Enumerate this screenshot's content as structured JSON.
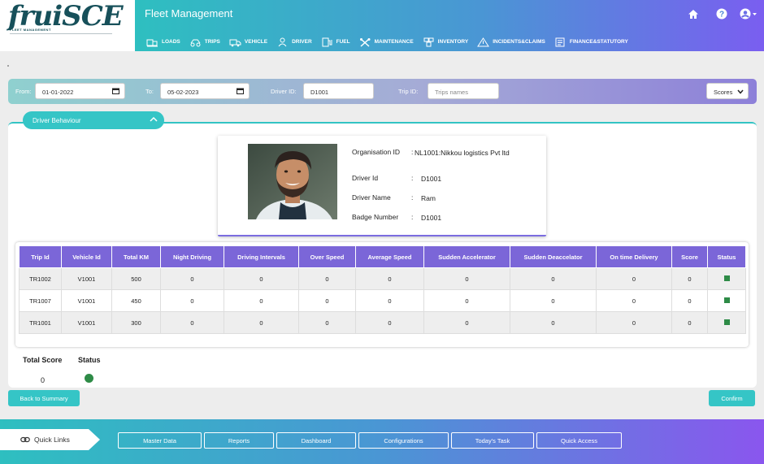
{
  "brand": {
    "logo": "fruiSCE",
    "tagline": "FLEET MANAGEMENT"
  },
  "header": {
    "title": "Fleet Management",
    "icons": [
      "home-icon",
      "help-icon",
      "user-account-icon"
    ]
  },
  "nav": [
    {
      "label": "LOADS",
      "icon": "loads-icon"
    },
    {
      "label": "TRIPS",
      "icon": "trips-icon"
    },
    {
      "label": "VEHICLE",
      "icon": "vehicle-icon"
    },
    {
      "label": "DRIVER",
      "icon": "driver-icon"
    },
    {
      "label": "FUEL",
      "icon": "fuel-icon"
    },
    {
      "label": "MAINTENANCE",
      "icon": "maintenance-icon"
    },
    {
      "label": "INVENTORY",
      "icon": "inventory-icon"
    },
    {
      "label": "INCIDENTS&CLAIMS",
      "icon": "incidents-icon"
    },
    {
      "label": "FINANCE&STATUTORY",
      "icon": "finance-icon"
    }
  ],
  "filters": {
    "from_label": "From:",
    "from_value": "01-01-2022",
    "to_label": "To:",
    "to_value": "05-02-2023",
    "driver_label": "Driver ID:",
    "driver_value": "D1001",
    "trip_label": "Trip ID:",
    "trip_placeholder": "Trips names",
    "scores_selected": "Scores"
  },
  "section": {
    "title": "Driver Behaviour"
  },
  "driver": {
    "org_label": "Organisation ID",
    "org_value": "NL1001:Nikkou logistics Pvt ltd",
    "id_label": "Driver Id",
    "id_value": "D1001",
    "name_label": "Driver Name",
    "name_value": "Ram",
    "badge_label": "Badge Number",
    "badge_value": "D1001",
    "colon": ":"
  },
  "table": {
    "headers": [
      "Trip Id",
      "Vehicle Id",
      "Total KM",
      "Night Driving",
      "Driving Intervals",
      "Over Speed",
      "Average Speed",
      "Sudden Accelerator",
      "Sudden Deaccelator",
      "On time Delivery",
      "Score",
      "Status"
    ],
    "rows": [
      [
        "TR1002",
        "V1001",
        "500",
        "0",
        "0",
        "0",
        "0",
        "0",
        "0",
        "0",
        "0",
        ""
      ],
      [
        "TR1007",
        "V1001",
        "450",
        "0",
        "0",
        "0",
        "0",
        "0",
        "0",
        "0",
        "0",
        ""
      ],
      [
        "TR1001",
        "V1001",
        "300",
        "0",
        "0",
        "0",
        "0",
        "0",
        "0",
        "0",
        "0",
        ""
      ]
    ],
    "status_color": "#2e8b47"
  },
  "summary": {
    "total_label": "Total Score",
    "total_value": "0",
    "status_label": "Status",
    "status_color": "#2e8b47"
  },
  "actions": {
    "back": "Back to Summary",
    "confirm": "Confirm"
  },
  "footer": {
    "quick_links": "Quick Links",
    "links": [
      "Master Data",
      "Reports",
      "Dashboard",
      "Configurations",
      "Today's Task",
      "Quick Access"
    ]
  },
  "colors": {
    "accent": "#35c5c6",
    "table_header": "#7b66d8",
    "status": "#2e8b47"
  }
}
